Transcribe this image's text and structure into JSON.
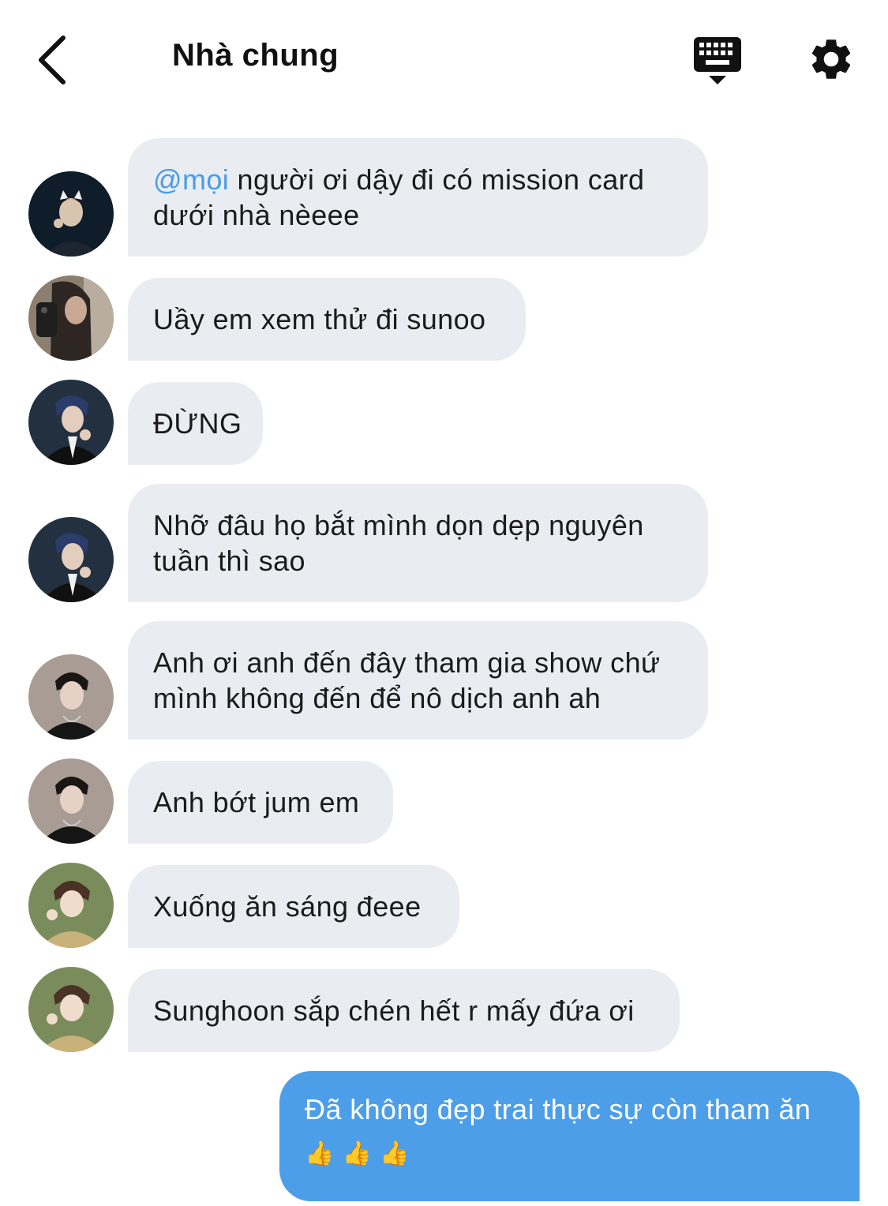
{
  "header": {
    "title": "Nhà chung",
    "back_icon": "chevron-left-icon",
    "keyboard_icon": "keyboard-icon",
    "settings_icon": "gear-icon"
  },
  "messages": [
    {
      "mention": "@mọi",
      "text": " người ơi dậy đi có mission card dưới nhà nèeee"
    },
    {
      "text": "Uầy em xem thử đi sunoo"
    },
    {
      "text": "ĐỪNG"
    },
    {
      "text": "Nhỡ đâu họ bắt mình dọn dẹp nguyên tuần thì sao"
    },
    {
      "text": "Anh ơi anh đến đây tham gia show chứ mình không đến để nô dịch anh ah"
    },
    {
      "text": "Anh bớt jum em"
    },
    {
      "text": "Xuống ăn sáng đeee"
    },
    {
      "text": "Sunghoon sắp chén hết r mấy đứa ơi"
    }
  ],
  "outgoing": {
    "text": "Đã không đẹp trai thực sự còn tham ăn",
    "emoji": "👍 👍 👍"
  },
  "colors": {
    "incoming_bubble": "#e9edf2",
    "outgoing_bubble": "#4d9ee9",
    "mention": "#4a9be8"
  }
}
